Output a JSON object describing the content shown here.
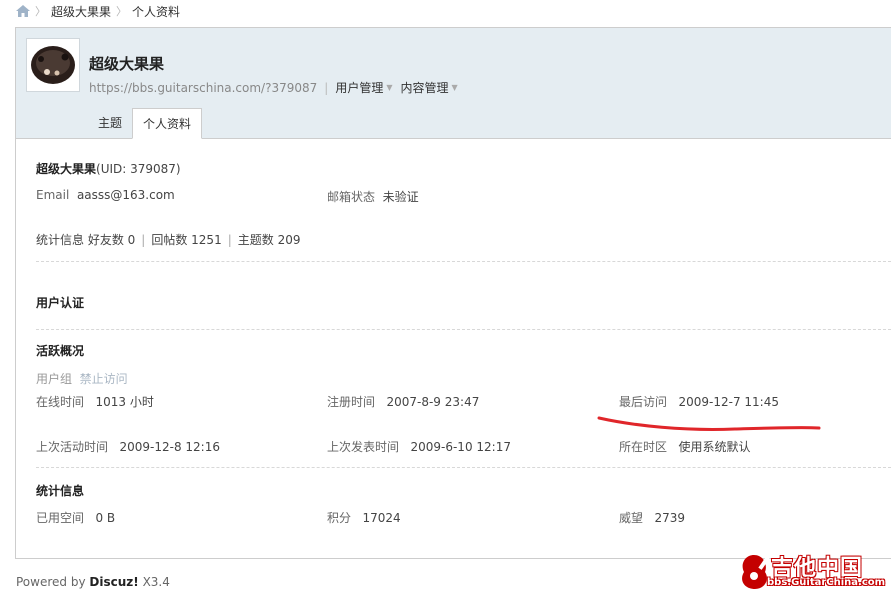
{
  "breadcrumb": {
    "home_icon": "home-icon",
    "items": [
      "超级大果果",
      "个人资料"
    ]
  },
  "header": {
    "username": "超级大果果",
    "url": "https://bbs.guitarschina.com/?379087",
    "menus": [
      "用户管理",
      "内容管理"
    ],
    "tabs": [
      "主题",
      "个人资料"
    ],
    "active_tab": "个人资料"
  },
  "profile": {
    "name": "超级大果果",
    "uid_text": "(UID: 379087)",
    "email_label": "Email",
    "email": "aasss@163.com",
    "mail_status_label": "邮箱状态",
    "mail_status": "未验证",
    "stats_label": "统计信息",
    "friends": "好友数 0",
    "replies": "回帖数 1251",
    "threads": "主题数 209"
  },
  "verify": {
    "title": "用户认证"
  },
  "activity": {
    "title": "活跃概况",
    "group_label": "用户组",
    "group_value": "禁止访问",
    "online_label": "在线时间",
    "online_value": "1013 小时",
    "reg_label": "注册时间",
    "reg_value": "2007-8-9 23:47",
    "last_visit_label": "最后访问",
    "last_visit_value": "2009-12-7 11:45",
    "last_active_label": "上次活动时间",
    "last_active_value": "2009-12-8 12:16",
    "last_post_label": "上次发表时间",
    "last_post_value": "2009-6-10 12:17",
    "timezone_label": "所在时区",
    "timezone_value": "使用系统默认"
  },
  "stats": {
    "title": "统计信息",
    "space_label": "已用空间",
    "space_value": "0 B",
    "credits_label": "积分",
    "credits_value": "17024",
    "prestige_label": "威望",
    "prestige_value": "2739"
  },
  "footer": {
    "powered": "Powered by",
    "brand": "Discuz!",
    "version": "X3.4"
  },
  "watermark": {
    "cn": "吉他中国",
    "en": "bbs.GuitarChina.com"
  },
  "colors": {
    "header_bg": "#e5edf2",
    "annotation_red": "#e0262a",
    "watermark_red": "#c40000"
  }
}
